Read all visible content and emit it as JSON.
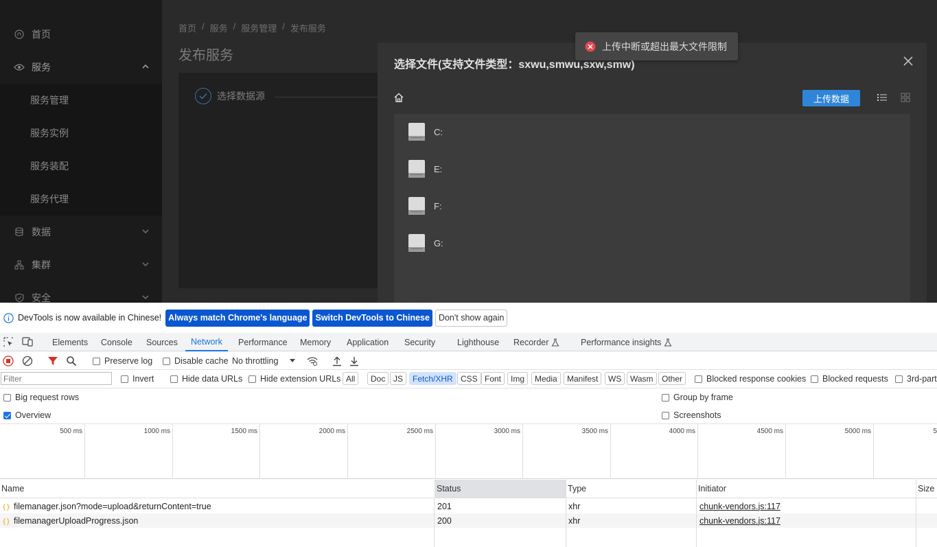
{
  "sidebar": {
    "items": [
      {
        "label": "首页",
        "icon": "home-circle-icon"
      },
      {
        "label": "服务",
        "icon": "eye-icon"
      },
      {
        "label": "服务管理"
      },
      {
        "label": "服务实例"
      },
      {
        "label": "服务装配"
      },
      {
        "label": "服务代理"
      },
      {
        "label": "数据",
        "icon": "database-icon"
      },
      {
        "label": "集群",
        "icon": "cluster-icon"
      },
      {
        "label": "安全",
        "icon": "shield-icon"
      }
    ]
  },
  "breadcrumb": [
    "首页",
    "服务",
    "服务管理",
    "发布服务"
  ],
  "breadcrumb_sep": "/",
  "page_title": "发布服务",
  "step": {
    "label": "选择数据源"
  },
  "modal": {
    "title": "选择文件(支持文件类型：sxwu,smwu,sxw,smw)",
    "upload_label": "上传数据",
    "drives": [
      "C:",
      "E:",
      "F:",
      "G:"
    ]
  },
  "toast": {
    "message": "上传中断或超出最大文件限制",
    "color": "#e5484d"
  },
  "devtools": {
    "lang_bar": {
      "message": "DevTools is now available in Chinese!",
      "btn_match": "Always match Chrome's language",
      "btn_switch": "Switch DevTools to Chinese",
      "btn_dismiss": "Don't show again"
    },
    "tabs": [
      "Elements",
      "Console",
      "Sources",
      "Network",
      "Performance",
      "Memory",
      "Application",
      "Security",
      "Lighthouse",
      "Recorder",
      "Performance insights"
    ],
    "active_tab": "Network",
    "toolbar": {
      "preserve_log": "Preserve log",
      "disable_cache": "Disable cache",
      "throttling": "No throttling"
    },
    "filter": {
      "placeholder": "Filter",
      "invert": "Invert",
      "hide_data_urls": "Hide data URLs",
      "hide_extension_urls": "Hide extension URLs",
      "types": [
        "All",
        "Doc",
        "JS",
        "Fetch/XHR",
        "CSS",
        "Font",
        "Img",
        "Media",
        "Manifest",
        "WS",
        "Wasm",
        "Other"
      ],
      "selected_type": "Fetch/XHR",
      "blocked_response_cookies": "Blocked response cookies",
      "blocked_requests": "Blocked requests",
      "third_party": "3rd-part"
    },
    "options": {
      "big_request_rows": "Big request rows",
      "overview": "Overview",
      "group_by_frame": "Group by frame",
      "screenshots": "Screenshots"
    },
    "timeline_ticks": [
      "500 ms",
      "1000 ms",
      "1500 ms",
      "2000 ms",
      "2500 ms",
      "3000 ms",
      "3500 ms",
      "4000 ms",
      "4500 ms",
      "5000 ms",
      "5"
    ],
    "table": {
      "columns": [
        "Name",
        "Status",
        "Type",
        "Initiator",
        "Size"
      ],
      "rows": [
        {
          "name": "filemanager.json?mode=upload&returnContent=true",
          "status": "201",
          "type": "xhr",
          "initiator": "chunk-vendors.js:117"
        },
        {
          "name": "filemanagerUploadProgress.json",
          "status": "200",
          "type": "xhr",
          "initiator": "chunk-vendors.js:117"
        }
      ]
    },
    "accent": "#1a73e8"
  }
}
